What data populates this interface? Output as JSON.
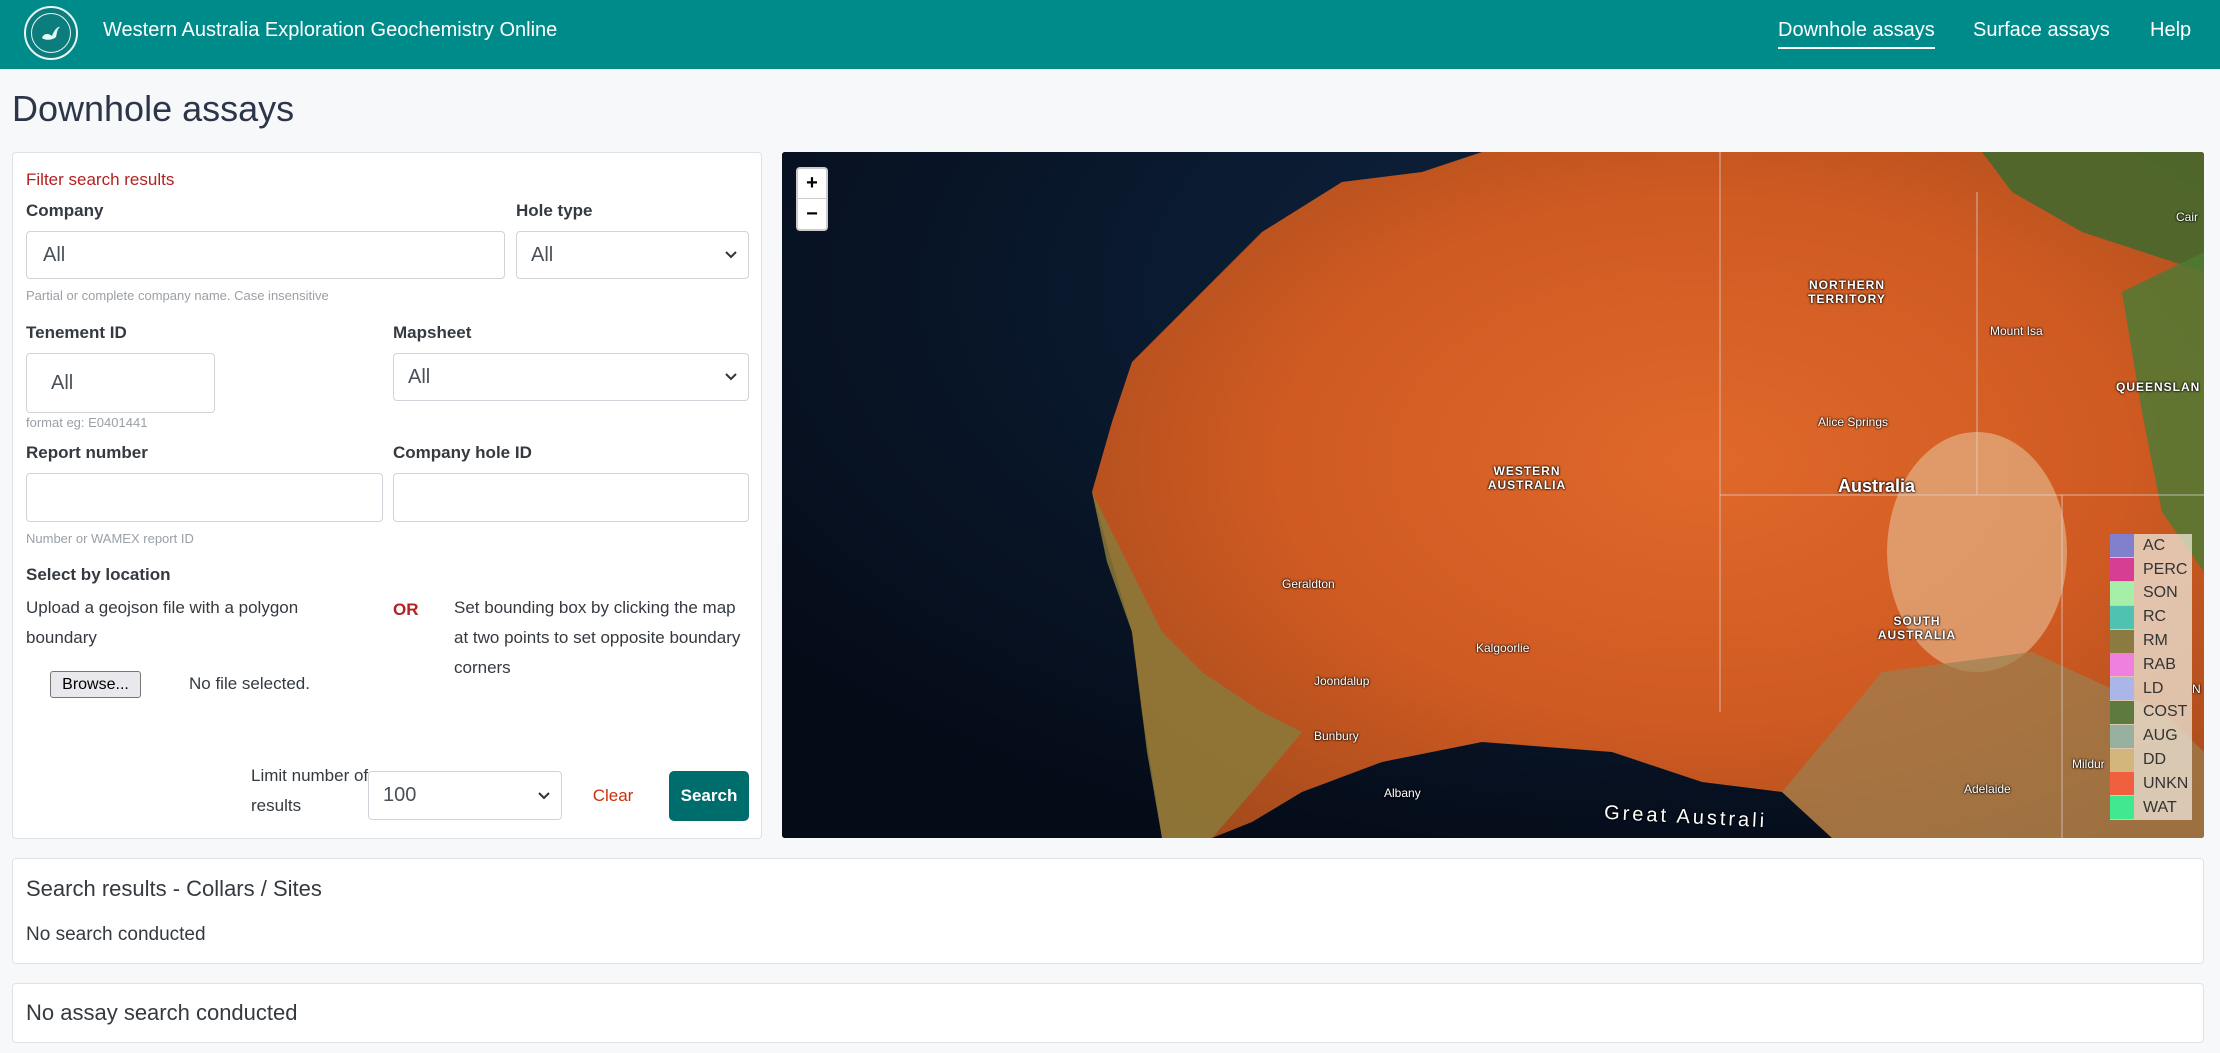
{
  "header": {
    "brand": "Western Australia Exploration Geochemistry Online",
    "nav": [
      {
        "label": "Downhole assays",
        "active": true
      },
      {
        "label": "Surface assays",
        "active": false
      },
      {
        "label": "Help",
        "active": false
      }
    ],
    "color": "#008b8b"
  },
  "page_title": "Downhole assays",
  "filter": {
    "heading": "Filter search results",
    "company": {
      "label": "Company",
      "value": "All",
      "hint": "Partial or complete company name. Case insensitive"
    },
    "hole_type": {
      "label": "Hole type",
      "value": "All"
    },
    "tenement": {
      "label": "Tenement ID",
      "value": "All",
      "hint": "format eg: E0401441"
    },
    "mapsheet": {
      "label": "Mapsheet",
      "value": "All"
    },
    "report_number": {
      "label": "Report number",
      "value": "",
      "hint": "Number or WAMEX report ID"
    },
    "company_hole": {
      "label": "Company hole ID",
      "value": ""
    },
    "location": {
      "label": "Select by location",
      "upload_text": "Upload a geojson file with a polygon boundary",
      "or": "OR",
      "bbox_text": "Set bounding box by clicking the map at two points to set opposite boundary corners",
      "browse_label": "Browse...",
      "no_file": "No file selected."
    },
    "limit": {
      "label": "Limit number of results",
      "value": "100"
    },
    "clear_label": "Clear",
    "search_label": "Search"
  },
  "map": {
    "zoom_in": "+",
    "zoom_out": "−",
    "labels": {
      "nt": "NORTHERN TERRITORY",
      "wa": "WESTERN AUSTRALIA",
      "qld": "QUEENSLAN",
      "sa": "SOUTH AUSTRALIA",
      "australia": "Australia",
      "mount_isa": "Mount Isa",
      "alice": "Alice Springs",
      "geraldton": "Geraldton",
      "kalgoorlie": "Kalgoorlie",
      "joondalup": "Joondalup",
      "bunbury": "Bunbury",
      "albany": "Albany",
      "adelaide": "Adelaide",
      "mildura": "Mildur",
      "cairns": "Cair",
      "bight": "Great Australi",
      "n_edge": "N"
    },
    "legend": [
      {
        "label": "AC",
        "color": "#8080cc"
      },
      {
        "label": "PERC",
        "color": "#d63e93"
      },
      {
        "label": "SON",
        "color": "#a6efa8"
      },
      {
        "label": "RC",
        "color": "#4fc2b2"
      },
      {
        "label": "RM",
        "color": "#8b7b40"
      },
      {
        "label": "RAB",
        "color": "#ef80e0"
      },
      {
        "label": "LD",
        "color": "#aab5ea"
      },
      {
        "label": "COST",
        "color": "#5e7a3e"
      },
      {
        "label": "AUG",
        "color": "#98b0a0"
      },
      {
        "label": "DD",
        "color": "#d2b67c"
      },
      {
        "label": "UNKN",
        "color": "#f0603e"
      },
      {
        "label": "WAT",
        "color": "#40e890"
      }
    ]
  },
  "results": {
    "title": "Search results - Collars / Sites",
    "status": "No search conducted"
  },
  "assay": {
    "title": "No assay search conducted"
  }
}
